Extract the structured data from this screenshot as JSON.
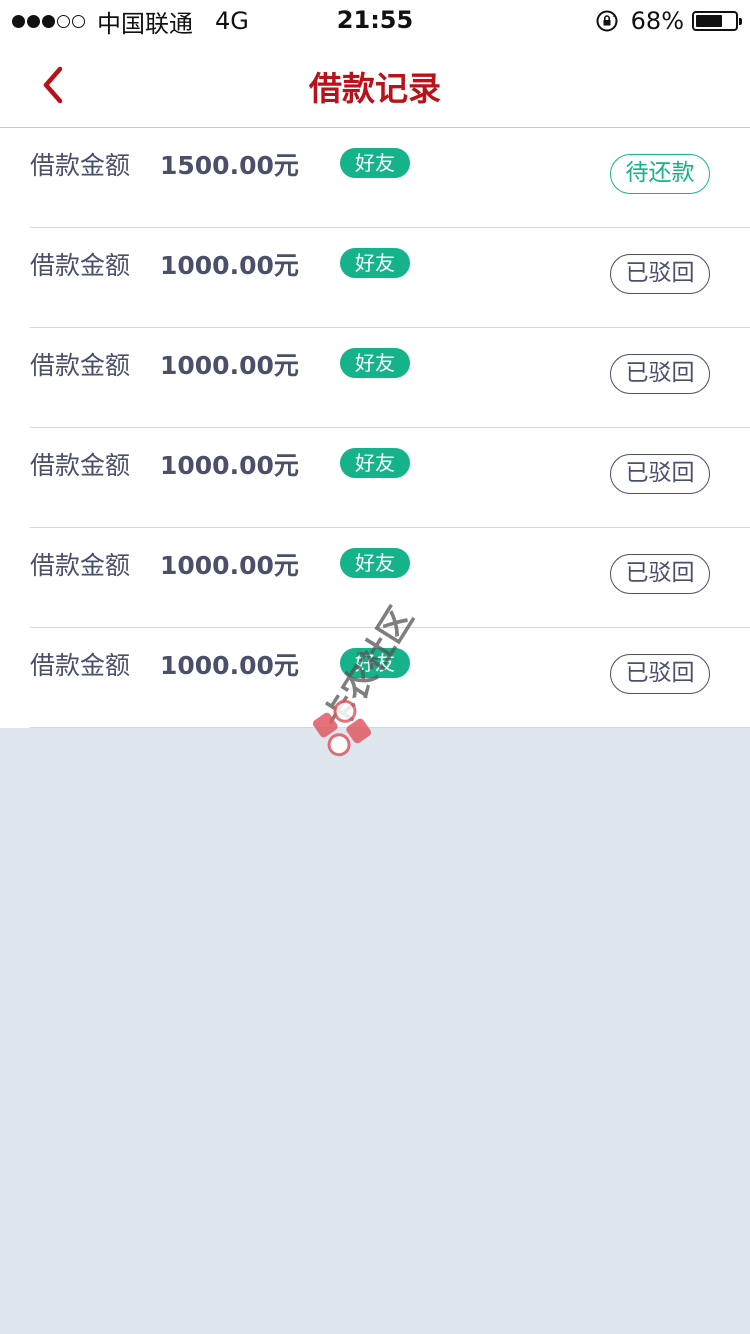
{
  "status_bar": {
    "carrier": "中国联通",
    "network": "4G",
    "time": "21:55",
    "battery_percent": "68%",
    "battery_level": 0.68,
    "signal_strength": 3,
    "signal_total": 5
  },
  "nav": {
    "title": "借款记录",
    "back_icon": "chevron-left-icon",
    "accent_color": "#b8121a"
  },
  "records": [
    {
      "label": "借款金额",
      "amount": "1500.00元",
      "tag": "好友",
      "status": "待还款",
      "status_type": "pending"
    },
    {
      "label": "借款金额",
      "amount": "1000.00元",
      "tag": "好友",
      "status": "已驳回",
      "status_type": "rejected"
    },
    {
      "label": "借款金额",
      "amount": "1000.00元",
      "tag": "好友",
      "status": "已驳回",
      "status_type": "rejected"
    },
    {
      "label": "借款金额",
      "amount": "1000.00元",
      "tag": "好友",
      "status": "已驳回",
      "status_type": "rejected"
    },
    {
      "label": "借款金额",
      "amount": "1000.00元",
      "tag": "好友",
      "status": "已驳回",
      "status_type": "rejected"
    },
    {
      "label": "借款金额",
      "amount": "1000.00元",
      "tag": "好友",
      "status": "已驳回",
      "status_type": "rejected"
    }
  ],
  "colors": {
    "tag_green": "#16b38a",
    "text_slate": "#4a4f6a",
    "background": "#dfe6ee"
  },
  "watermark": {
    "text": "卡农社区",
    "icon": "kanong-logo-icon"
  }
}
